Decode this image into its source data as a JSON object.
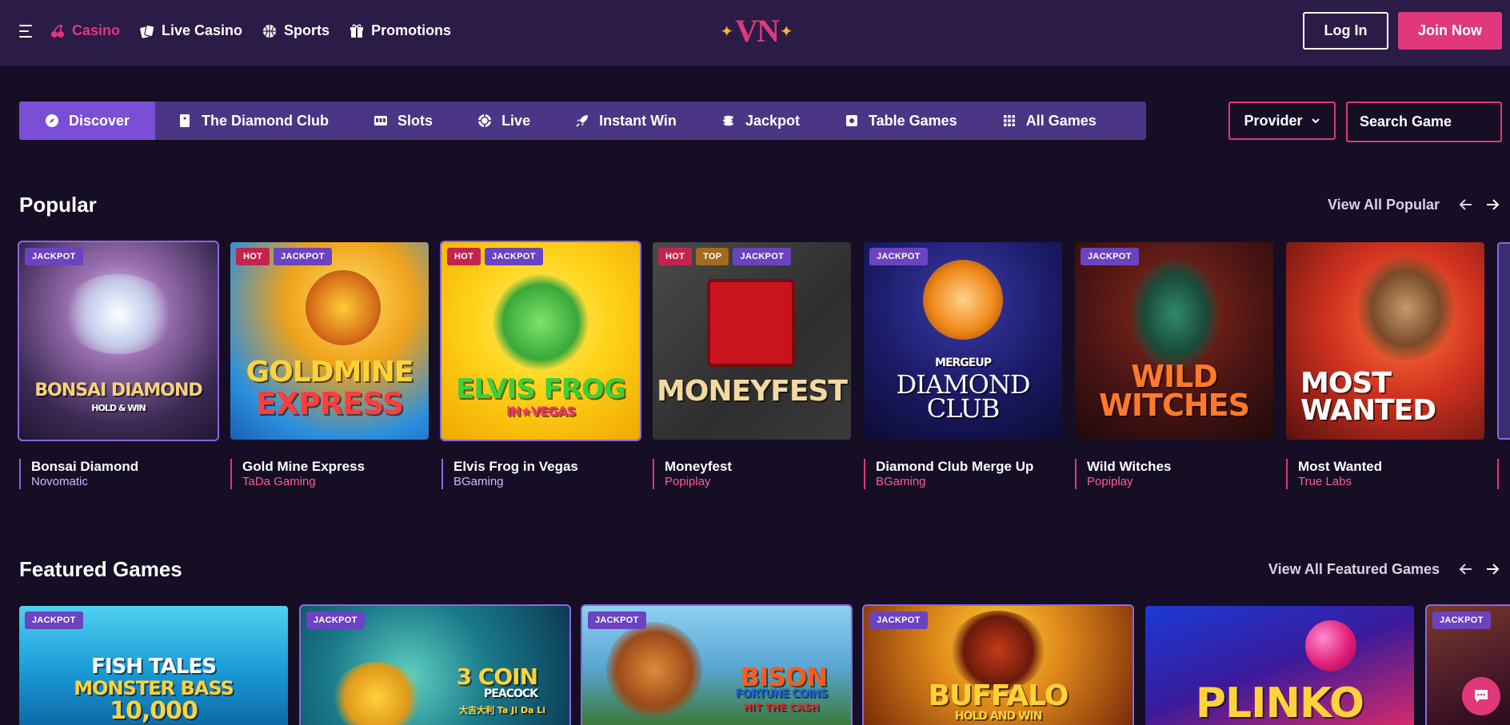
{
  "header": {
    "nav": [
      {
        "label": "Casino",
        "icon": "cherries-icon",
        "active": true
      },
      {
        "label": "Live Casino",
        "icon": "cards-icon"
      },
      {
        "label": "Sports",
        "icon": "ball-icon"
      },
      {
        "label": "Promotions",
        "icon": "gift-icon"
      }
    ],
    "logo_text": "VN",
    "login_label": "Log In",
    "join_label": "Join Now"
  },
  "categories": [
    {
      "label": "Discover",
      "icon": "compass-icon",
      "active": true
    },
    {
      "label": "The Diamond Club",
      "icon": "bookmark-card-icon"
    },
    {
      "label": "Slots",
      "icon": "slot-machine-icon"
    },
    {
      "label": "Live",
      "icon": "chip-icon"
    },
    {
      "label": "Instant Win",
      "icon": "rocket-icon"
    },
    {
      "label": "Jackpot",
      "icon": "coins-stack-icon"
    },
    {
      "label": "Table Games",
      "icon": "table-square-icon"
    },
    {
      "label": "All Games",
      "icon": "grid-icon"
    }
  ],
  "filters": {
    "provider_label": "Provider",
    "search_placeholder": "Search Game"
  },
  "popular": {
    "title": "Popular",
    "view_all": "View All Popular",
    "games": [
      {
        "name": "Bonsai Diamond",
        "provider": "Novomatic",
        "badges": [
          "JACKPOT"
        ],
        "art_line1": "BONSAI DIAMOND",
        "art_line2": "HOLD & WIN"
      },
      {
        "name": "Gold Mine Express",
        "provider": "TaDa Gaming",
        "badges": [
          "HOT",
          "JACKPOT"
        ],
        "art_line1": "GOLDMINE",
        "art_line2": "EXPRESS"
      },
      {
        "name": "Elvis Frog in Vegas",
        "provider": "BGaming",
        "badges": [
          "HOT",
          "JACKPOT"
        ],
        "art_line1": "ELVIS FROG",
        "art_line2": "IN★VEGAS"
      },
      {
        "name": "Moneyfest",
        "provider": "Popiplay",
        "badges": [
          "HOT",
          "TOP",
          "JACKPOT"
        ],
        "art_line1": "MONEYFEST",
        "art_line2": ""
      },
      {
        "name": "Diamond Club Merge Up",
        "provider": "BGaming",
        "badges": [
          "JACKPOT"
        ],
        "art_line1": "MERGEUP",
        "art_line2": "DIAMOND CLUB"
      },
      {
        "name": "Wild Witches",
        "provider": "Popiplay",
        "badges": [
          "JACKPOT"
        ],
        "art_line1": "WILD",
        "art_line2": "WITCHES"
      },
      {
        "name": "Most Wanted",
        "provider": "True Labs",
        "badges": [],
        "art_line1": "MOST",
        "art_line2": "WANTED"
      }
    ]
  },
  "featured": {
    "title": "Featured Games",
    "view_all": "View All Featured Games",
    "games": [
      {
        "badges": [
          "JACKPOT"
        ],
        "art_line1": "FISH TALES",
        "art_line2": "MONSTER BASS",
        "art_line3": "10,000"
      },
      {
        "badges": [
          "JACKPOT"
        ],
        "art_line1": "3 COIN",
        "art_line2": "PEACOCK",
        "art_line3": "大吉大利 Ta Ji Da Li"
      },
      {
        "badges": [
          "JACKPOT"
        ],
        "art_line1": "BISON",
        "art_line2": "FORTUNE COINS",
        "art_line3": "HIT THE CASH"
      },
      {
        "badges": [
          "JACKPOT"
        ],
        "art_line1": "BUFFALO",
        "art_line2": "HOLD AND WIN",
        "art_line3": ""
      },
      {
        "badges": [],
        "art_line1": "PLINKO",
        "art_line2": "",
        "art_line3": ""
      },
      {
        "badges": [
          "JACKPOT"
        ],
        "art_line1": "",
        "art_line2": "",
        "art_line3": ""
      }
    ]
  },
  "colors": {
    "background": "#150e24",
    "header": "#2a1b47",
    "accent": "#e0387a",
    "category_bar": "#4a3685",
    "category_active": "#7a4fd6"
  }
}
